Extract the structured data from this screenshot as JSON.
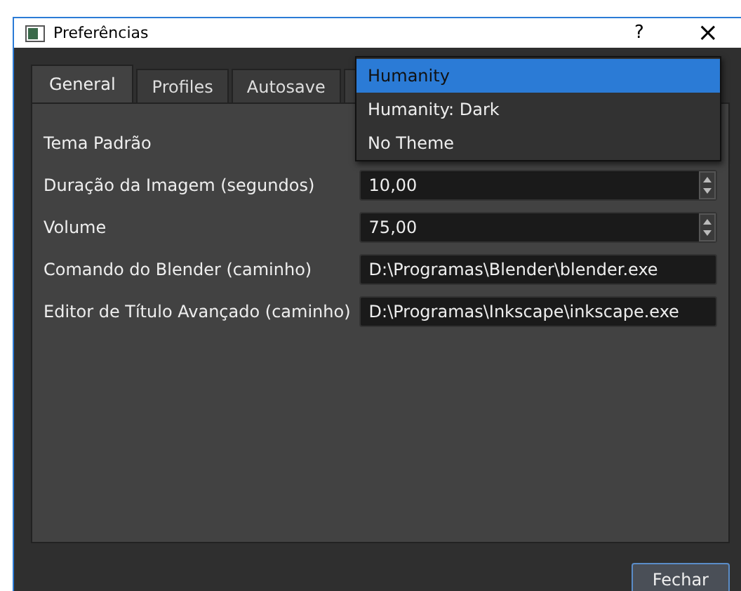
{
  "window": {
    "title": "Preferências",
    "help": "?",
    "close": "×"
  },
  "tabs": [
    {
      "label": "General",
      "selected": true
    },
    {
      "label": "Profiles",
      "selected": false
    },
    {
      "label": "Autosave",
      "selected": false
    }
  ],
  "fields": [
    {
      "label": "Tema Padrão",
      "kind": "combo"
    },
    {
      "label": "Duração da Imagem (segundos)",
      "kind": "spin",
      "value": "10,00"
    },
    {
      "label": "Volume",
      "kind": "spin",
      "value": "75,00"
    },
    {
      "label": "Comando do Blender (caminho)",
      "kind": "text",
      "value": "D:\\Programas\\Blender\\blender.exe"
    },
    {
      "label": "Editor de Título Avançado (caminho)",
      "kind": "text",
      "value": "D:\\Programas\\Inkscape\\inkscape.exe"
    }
  ],
  "dropdown": [
    {
      "label": "Humanity",
      "selected": true
    },
    {
      "label": "Humanity: Dark",
      "selected": false
    },
    {
      "label": "No Theme",
      "selected": false
    }
  ],
  "buttons": [
    "Fechar"
  ]
}
